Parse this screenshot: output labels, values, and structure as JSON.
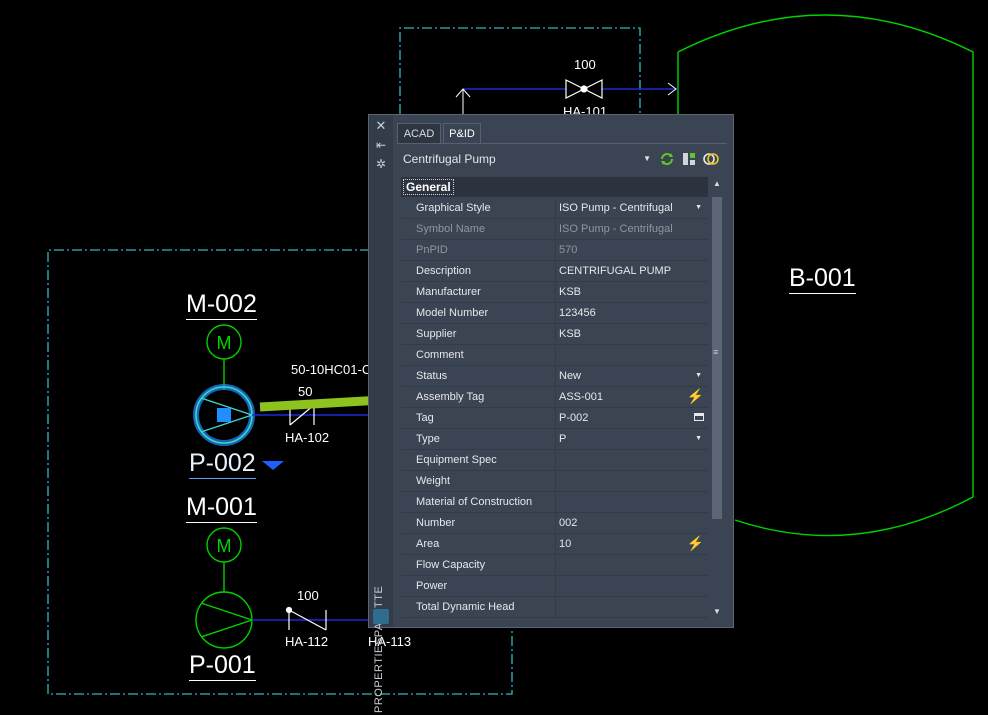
{
  "drawing": {
    "equipment": {
      "motor_upper_tag": "M-002",
      "pump_selected_tag": "P-002",
      "motor_lower_tag": "M-001",
      "pump_lower_tag": "P-001",
      "vessel_tag": "B-001"
    },
    "motor_symbol_letter": "M",
    "lines": {
      "line_number": "50-10HC01-C",
      "size_upper_left": "50",
      "size_top": "100",
      "size_lower": "100"
    },
    "valves": {
      "top": "HA-101",
      "left_upper": "HA-102",
      "left_lower": "HA-112",
      "lower_right": "HA-113"
    },
    "colors": {
      "equipment": "#00d200",
      "pipe": "#1a2bd8",
      "selection": "#1f8fff",
      "boundary": "#33b5c4",
      "arrow": "#8dc21f"
    }
  },
  "palette": {
    "strip_title": "PROPERTIESPALETTE",
    "tabs": [
      "ACAD",
      "P&ID"
    ],
    "active_tab": "P&ID",
    "selector_value": "Centrifugal Pump",
    "section": "General",
    "properties": [
      {
        "name": "Graphical Style",
        "value": "ISO Pump - Centrifugal",
        "control": "dropdown"
      },
      {
        "name": "Symbol Name",
        "value": "ISO Pump - Centrifugal",
        "disabled": true
      },
      {
        "name": "PnPID",
        "value": "570",
        "disabled": true
      },
      {
        "name": "Description",
        "value": "CENTRIFUGAL PUMP"
      },
      {
        "name": "Manufacturer",
        "value": "KSB"
      },
      {
        "name": "Model Number",
        "value": "123456"
      },
      {
        "name": "Supplier",
        "value": "KSB"
      },
      {
        "name": "Comment",
        "value": ""
      },
      {
        "name": "Status",
        "value": "New",
        "control": "dropdown"
      },
      {
        "name": "Assembly Tag",
        "value": "ASS-001",
        "control": "lightning"
      },
      {
        "name": "Tag",
        "value": "P-002",
        "control": "dialog"
      },
      {
        "name": "Type",
        "value": "P",
        "control": "dropdown"
      },
      {
        "name": "Equipment Spec",
        "value": ""
      },
      {
        "name": "Weight",
        "value": ""
      },
      {
        "name": "Material of Construction",
        "value": ""
      },
      {
        "name": "Number",
        "value": "002"
      },
      {
        "name": "Area",
        "value": "10",
        "control": "lightning"
      },
      {
        "name": "Flow Capacity",
        "value": ""
      },
      {
        "name": "Power",
        "value": ""
      },
      {
        "name": "Total Dynamic Head",
        "value": ""
      }
    ]
  }
}
